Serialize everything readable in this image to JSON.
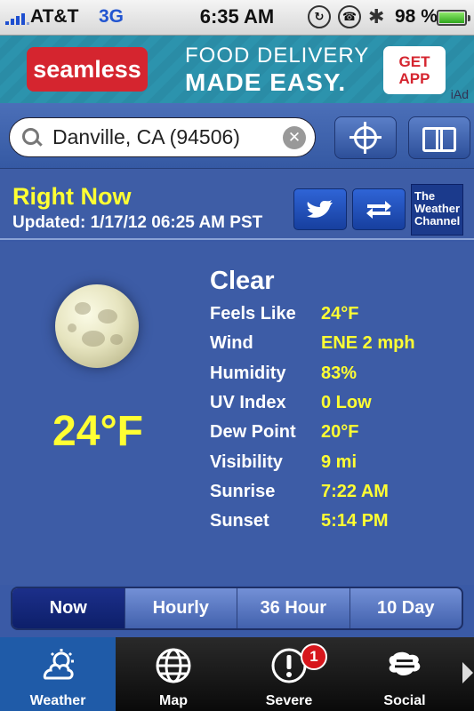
{
  "status_bar": {
    "carrier": "AT&T",
    "network": "3G",
    "time": "6:35 AM",
    "battery_percent": "98 %"
  },
  "ad": {
    "brand": "seamless",
    "headline_1": "FOOD DELIVERY",
    "headline_2": "MADE EASY.",
    "cta": "GET APP",
    "tag": "iAd"
  },
  "search": {
    "value": "Danville, CA (94506)"
  },
  "right_now": {
    "title": "Right Now",
    "updated": "Updated: 1/17/12 06:25 AM PST",
    "provider": "The Weather Channel"
  },
  "current": {
    "condition": "Clear",
    "temperature": "24°F",
    "details": [
      {
        "label": "Feels Like",
        "value": "24°F"
      },
      {
        "label": "Wind",
        "value": "ENE 2 mph"
      },
      {
        "label": "Humidity",
        "value": "83%"
      },
      {
        "label": "UV Index",
        "value": "0 Low"
      },
      {
        "label": "Dew Point",
        "value": "20°F"
      },
      {
        "label": "Visibility",
        "value": "9 mi"
      },
      {
        "label": "Sunrise",
        "value": "7:22 AM"
      },
      {
        "label": "Sunset",
        "value": "5:14 PM"
      }
    ]
  },
  "forecast_tabs": [
    "Now",
    "Hourly",
    "36 Hour",
    "10 Day"
  ],
  "tab_bar": {
    "items": [
      {
        "label": "Weather",
        "icon": "weather-cloud-sun-icon"
      },
      {
        "label": "Map",
        "icon": "globe-icon"
      },
      {
        "label": "Severe",
        "icon": "alert-icon"
      },
      {
        "label": "Social",
        "icon": "social-cloud-icon"
      }
    ],
    "severe_badge": "1"
  },
  "colors": {
    "background": "#3d5ca6",
    "highlight": "#ffff33",
    "active_tab": "#1f5ba8"
  }
}
